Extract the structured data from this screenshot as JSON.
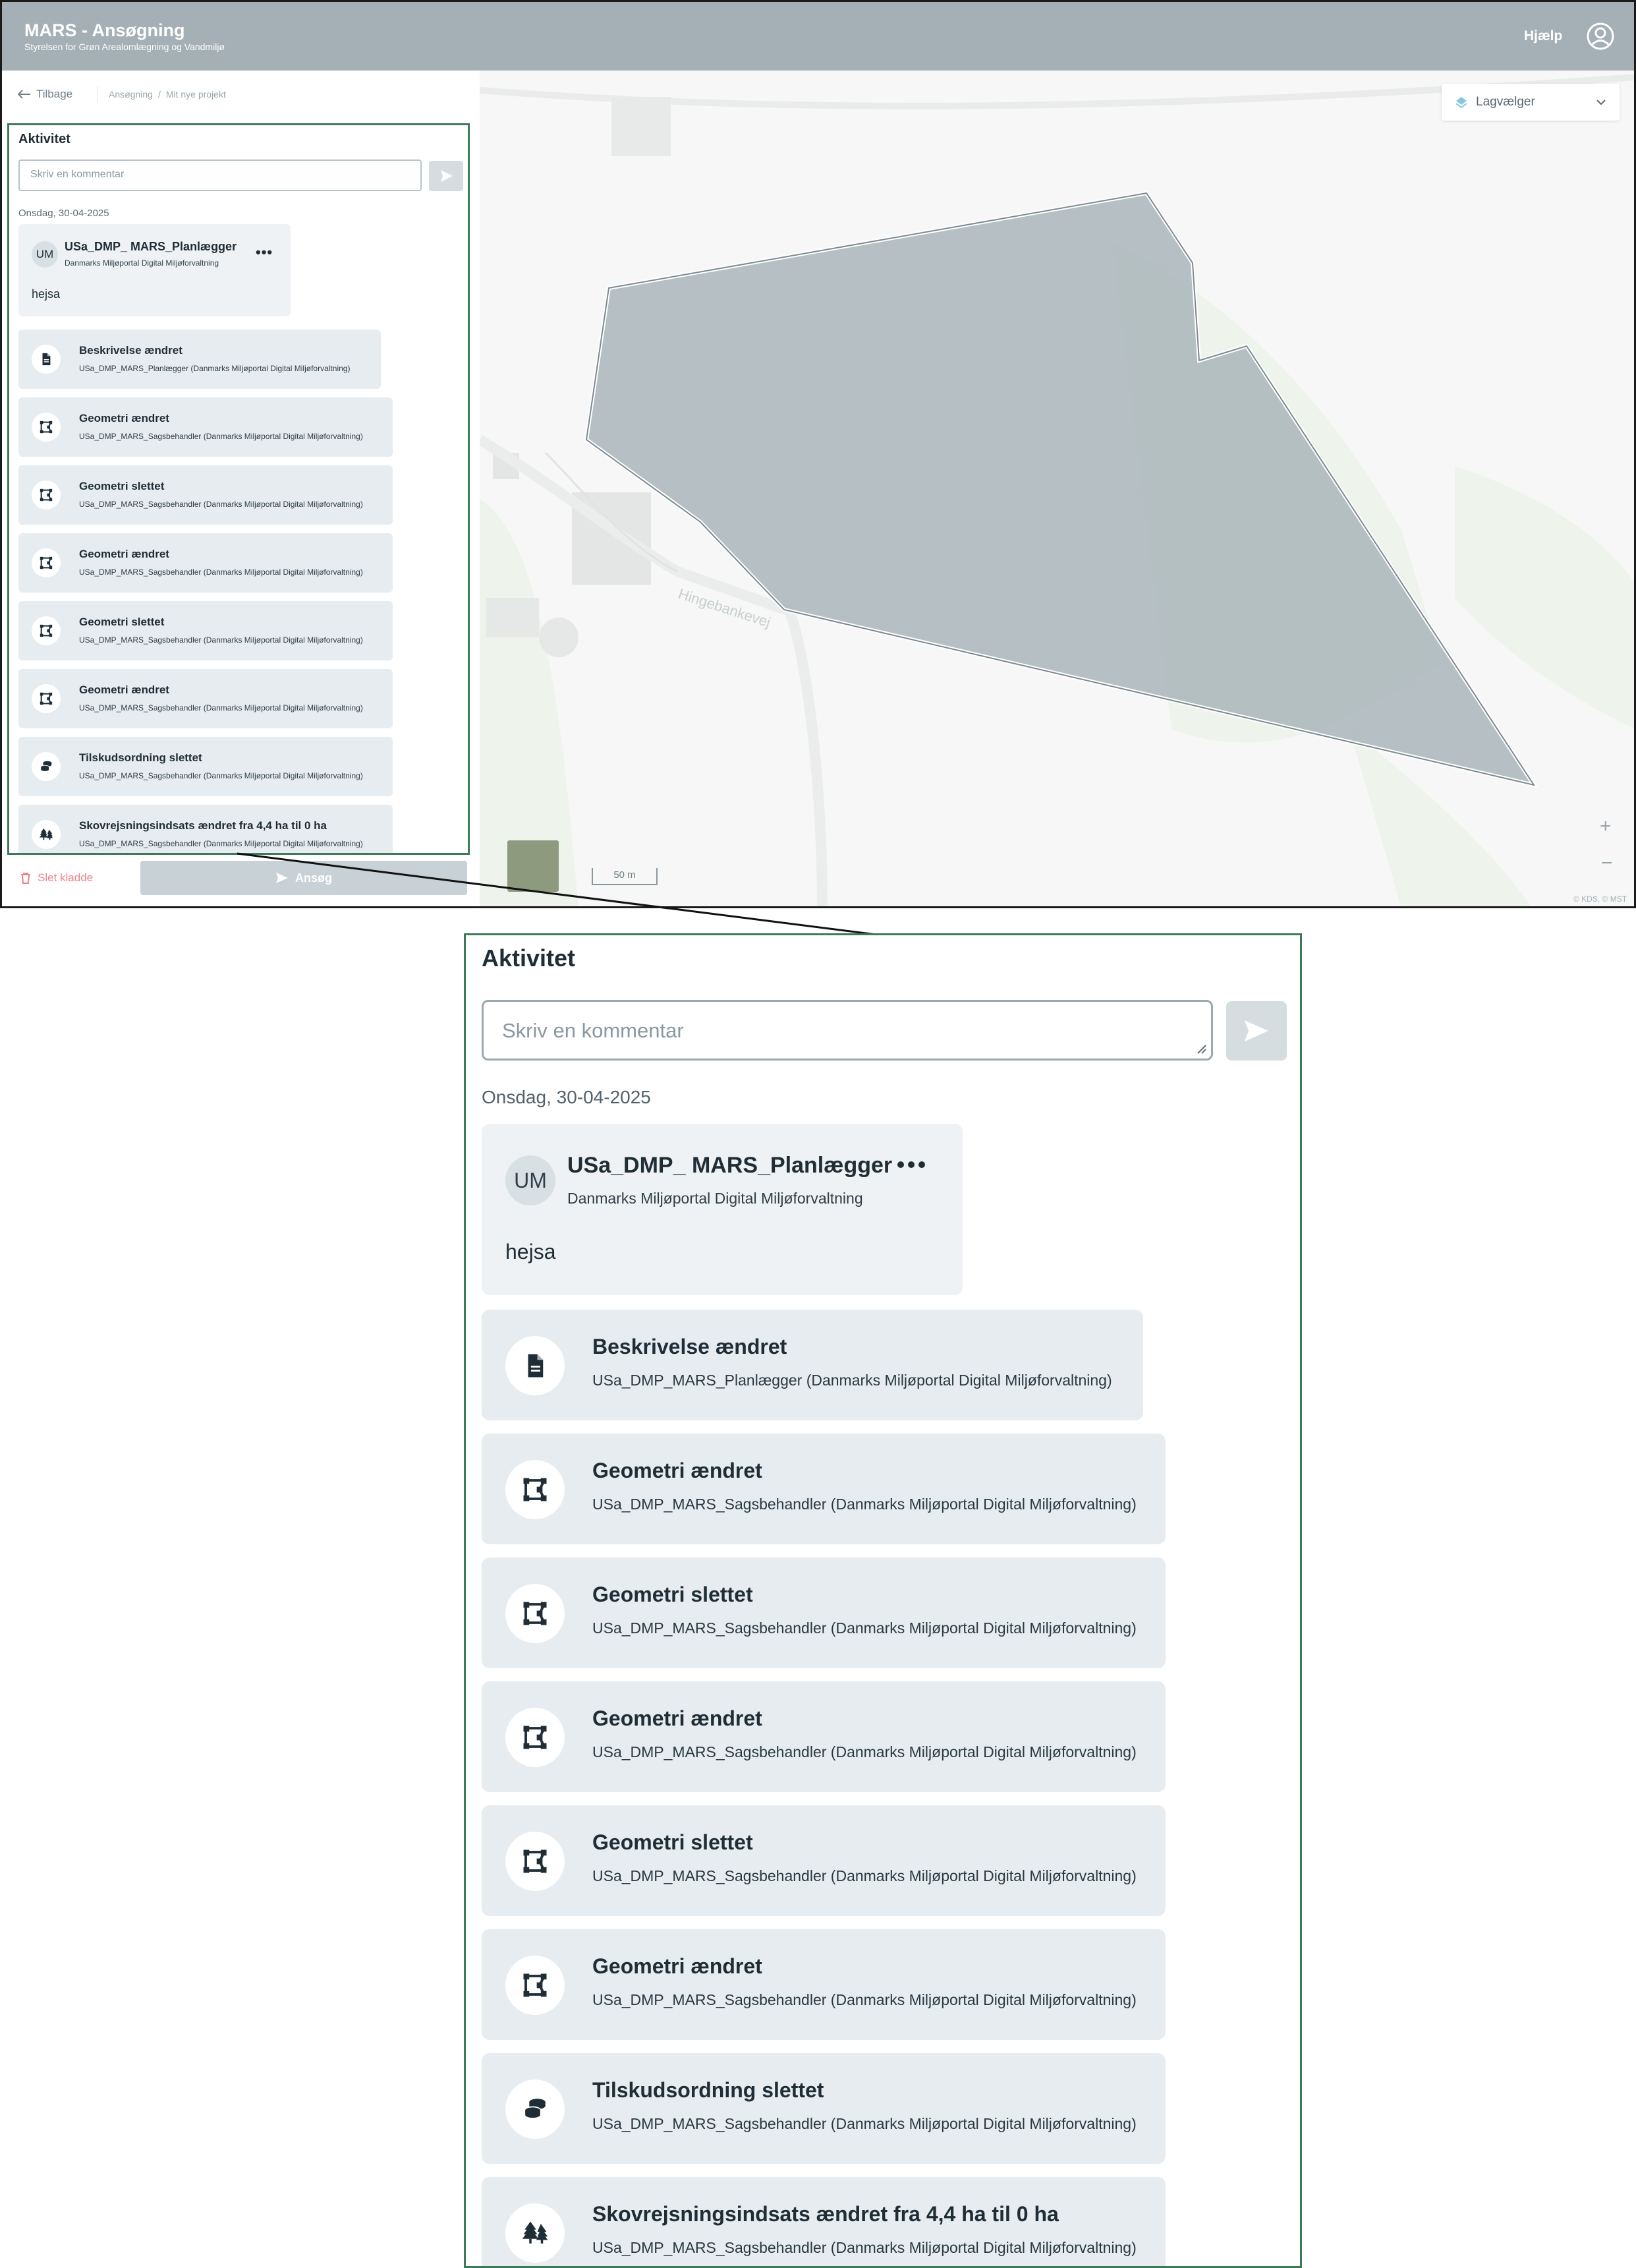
{
  "header": {
    "title": "MARS - Ansøgning",
    "subtitle": "Styrelsen for Grøn Arealomlægning og Vandmiljø",
    "help_label": "Hjælp"
  },
  "nav": {
    "back_label": "Tilbage",
    "breadcrumb": [
      "Ansøgning",
      "/",
      "Mit nye projekt"
    ]
  },
  "activity": {
    "title": "Aktivitet",
    "comment_placeholder": "Skriv en kommentar",
    "date": "Onsdag, 30-04-2025",
    "comment": {
      "avatar": "UM",
      "author": "USa_DMP_ MARS_Planlægger",
      "org": "Danmarks Miljøportal Digital Miljøforvaltning",
      "text": "hejsa"
    },
    "events": [
      {
        "icon": "document-icon",
        "title": "Beskrivelse ændret",
        "sub": "USa_DMP_MARS_Planlægger (Danmarks Miljøportal Digital Miljøforvaltning)"
      },
      {
        "icon": "polygon-icon",
        "title": "Geometri ændret",
        "sub": "USa_DMP_MARS_Sagsbehandler (Danmarks Miljøportal Digital Miljøforvaltning)"
      },
      {
        "icon": "polygon-icon",
        "title": "Geometri slettet",
        "sub": "USa_DMP_MARS_Sagsbehandler (Danmarks Miljøportal Digital Miljøforvaltning)"
      },
      {
        "icon": "polygon-icon",
        "title": "Geometri ændret",
        "sub": "USa_DMP_MARS_Sagsbehandler (Danmarks Miljøportal Digital Miljøforvaltning)"
      },
      {
        "icon": "polygon-icon",
        "title": "Geometri slettet",
        "sub": "USa_DMP_MARS_Sagsbehandler (Danmarks Miljøportal Digital Miljøforvaltning)"
      },
      {
        "icon": "polygon-icon",
        "title": "Geometri ændret",
        "sub": "USa_DMP_MARS_Sagsbehandler (Danmarks Miljøportal Digital Miljøforvaltning)"
      },
      {
        "icon": "coins-icon",
        "title": "Tilskudsordning slettet",
        "sub": "USa_DMP_MARS_Sagsbehandler (Danmarks Miljøportal Digital Miljøforvaltning)"
      },
      {
        "icon": "trees-icon",
        "title": "Skovrejsningsindsats ændret fra 4,4 ha til 0 ha",
        "sub": "USa_DMP_MARS_Sagsbehandler (Danmarks Miljøportal Digital Miljøforvaltning)"
      }
    ]
  },
  "actions": {
    "delete_label": "Slet kladde",
    "apply_label": "Ansøg"
  },
  "map": {
    "layer_selector_label": "Lagvælger",
    "road_label": "Hingebankevej",
    "scale_label": "50 m",
    "zoom_in": "+",
    "zoom_out": "−",
    "attribution": "© KDS, © MST"
  },
  "colors": {
    "header": "#a4b0b6",
    "panel_border": "#3d7a5a",
    "card_bg": "#e6ecef",
    "polygon_fill": "#a9b5bb"
  }
}
